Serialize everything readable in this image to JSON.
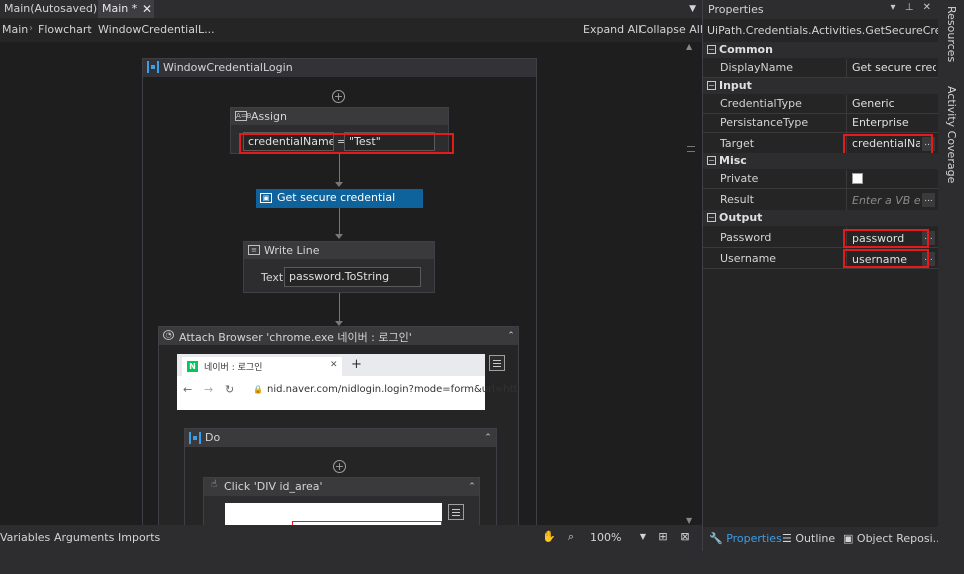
{
  "tabs": [
    {
      "label": "Main(Autosaved)"
    },
    {
      "label": "Main *"
    }
  ],
  "breadcrumb": {
    "items": [
      "Main",
      "Flowchart",
      "WindowCredentialL..."
    ],
    "expand_all": "Expand All",
    "collapse_all": "Collapse All"
  },
  "workflow": {
    "sequence_title": "WindowCredentialLogin",
    "assign": {
      "title": "Assign",
      "to": "credentialName",
      "equals": "=",
      "value": "\"Test\""
    },
    "get_secure_credential": {
      "title": "Get secure credential"
    },
    "write_line": {
      "title": "Write Line",
      "text_label": "Text",
      "text_value": "password.ToString"
    },
    "attach_browser": {
      "title": "Attach Browser 'chrome.exe  네이버 : 로그인'",
      "browser_tab": "네이버 : 로그인",
      "new_tab": "+",
      "url": "nid.naver.com/nidlogin.login?mode=form&url=htt"
    },
    "do": {
      "title": "Do"
    },
    "click": {
      "title": "Click 'DIV  id_area'"
    }
  },
  "bottombar": {
    "tabs": [
      "Variables",
      "Arguments",
      "Imports"
    ],
    "zoom": "100%"
  },
  "properties": {
    "title": "Properties",
    "activity_type": "UiPath.Credentials.Activities.GetSecureCredential",
    "categories": [
      {
        "name": "Common",
        "rows": [
          {
            "name": "DisplayName",
            "value": "Get secure credent"
          }
        ]
      },
      {
        "name": "Input",
        "rows": [
          {
            "name": "CredentialType",
            "value": "Generic"
          },
          {
            "name": "PersistanceType",
            "value": "Enterprise"
          },
          {
            "name": "Target",
            "value": "credentialNar"
          }
        ]
      },
      {
        "name": "Misc",
        "rows": [
          {
            "name": "Private",
            "value": ""
          },
          {
            "name": "Result",
            "value": "Enter a VB ex"
          }
        ]
      },
      {
        "name": "Output",
        "rows": [
          {
            "name": "Password",
            "value": "password"
          },
          {
            "name": "Username",
            "value": "username"
          }
        ]
      }
    ],
    "footer_tabs": [
      "Properties",
      "Outline",
      "Object Reposi..."
    ]
  },
  "side_tabs": [
    "Resources",
    "Activity Coverage"
  ],
  "colors": {
    "highlight": "#e31b1b",
    "accent": "#0e639c",
    "link": "#3c9ee5"
  }
}
